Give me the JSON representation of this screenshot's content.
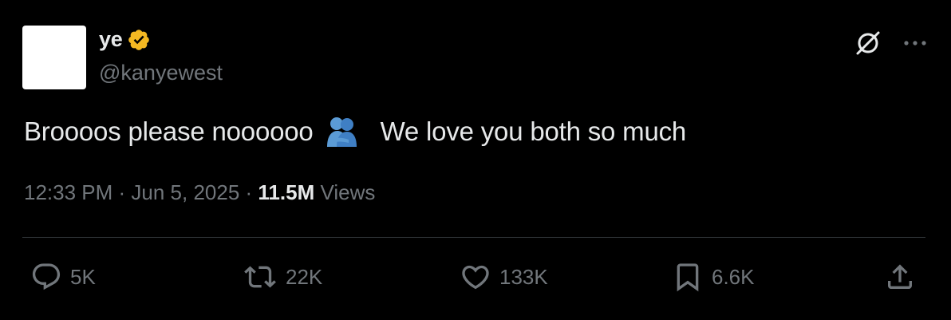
{
  "author": {
    "display_name": "ye",
    "handle": "@kanyewest",
    "verified": true,
    "verified_color": "#f4b822"
  },
  "header_actions": {
    "grok_icon": "grok-icon",
    "more_icon": "more-dots-icon"
  },
  "tweet": {
    "text_part1": "Broooos please noooooo",
    "emoji": "people-hugging-emoji",
    "text_part2": "We love you both so much"
  },
  "meta": {
    "time": "12:33 PM",
    "separator1": " · ",
    "date": "Jun 5, 2025",
    "separator2": " · ",
    "views_count": "11.5M",
    "views_label": " Views"
  },
  "actions": {
    "replies": "5K",
    "reposts": "22K",
    "likes": "133K",
    "bookmarks": "6.6K"
  },
  "colors": {
    "background": "#000000",
    "primary_text": "#e7e9ea",
    "secondary_text": "#71767b",
    "divider": "#2f3336"
  }
}
